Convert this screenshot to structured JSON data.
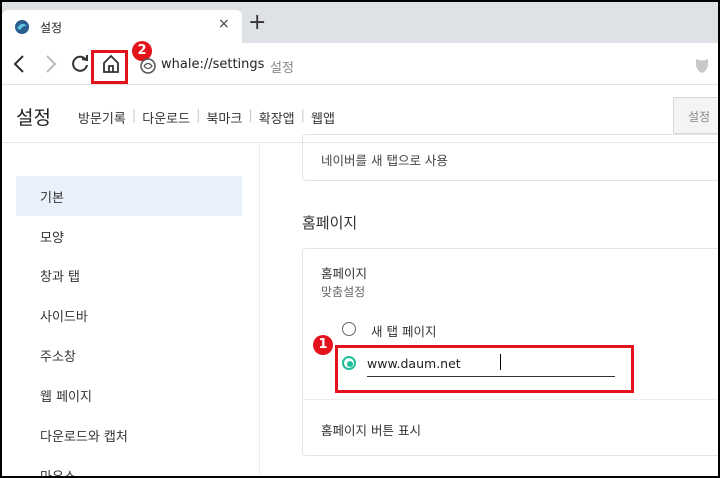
{
  "tab": {
    "title": "설정",
    "close": "×",
    "new_tab": "+"
  },
  "toolbar": {
    "url": "whale://settings",
    "url_tag": "설정"
  },
  "annotations": {
    "badge_1": "1",
    "badge_2": "2",
    "highlight_color": "#e3121b"
  },
  "header": {
    "title": "설정",
    "nav": [
      "방문기록",
      "다운로드",
      "북마크",
      "확장앱",
      "웹앱"
    ],
    "search": "설정"
  },
  "sidebar": {
    "items": [
      "기본",
      "모양",
      "창과 탭",
      "사이드바",
      "주소창",
      "웹 페이지",
      "다운로드와 캡처",
      "마우스"
    ],
    "active": "기본"
  },
  "main": {
    "naver_new_tab": "네이버를 새 탭으로 사용",
    "homepage_heading": "홈페이지",
    "homepage_label": "홈페이지",
    "homepage_sub": "맞춤설정",
    "option_new_tab": "새 탭 페이지",
    "option_url_value": "www.daum.net",
    "show_home_button": "홈페이지 버튼 표시",
    "accent_color": "#1fbf9b"
  }
}
